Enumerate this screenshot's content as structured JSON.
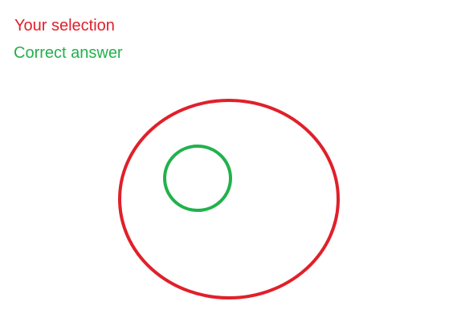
{
  "legend": {
    "selection_label": "Your selection",
    "correct_label": "Correct answer"
  },
  "colors": {
    "selection": "#e0202a",
    "correct": "#22b14c",
    "background": "#ffffff"
  }
}
